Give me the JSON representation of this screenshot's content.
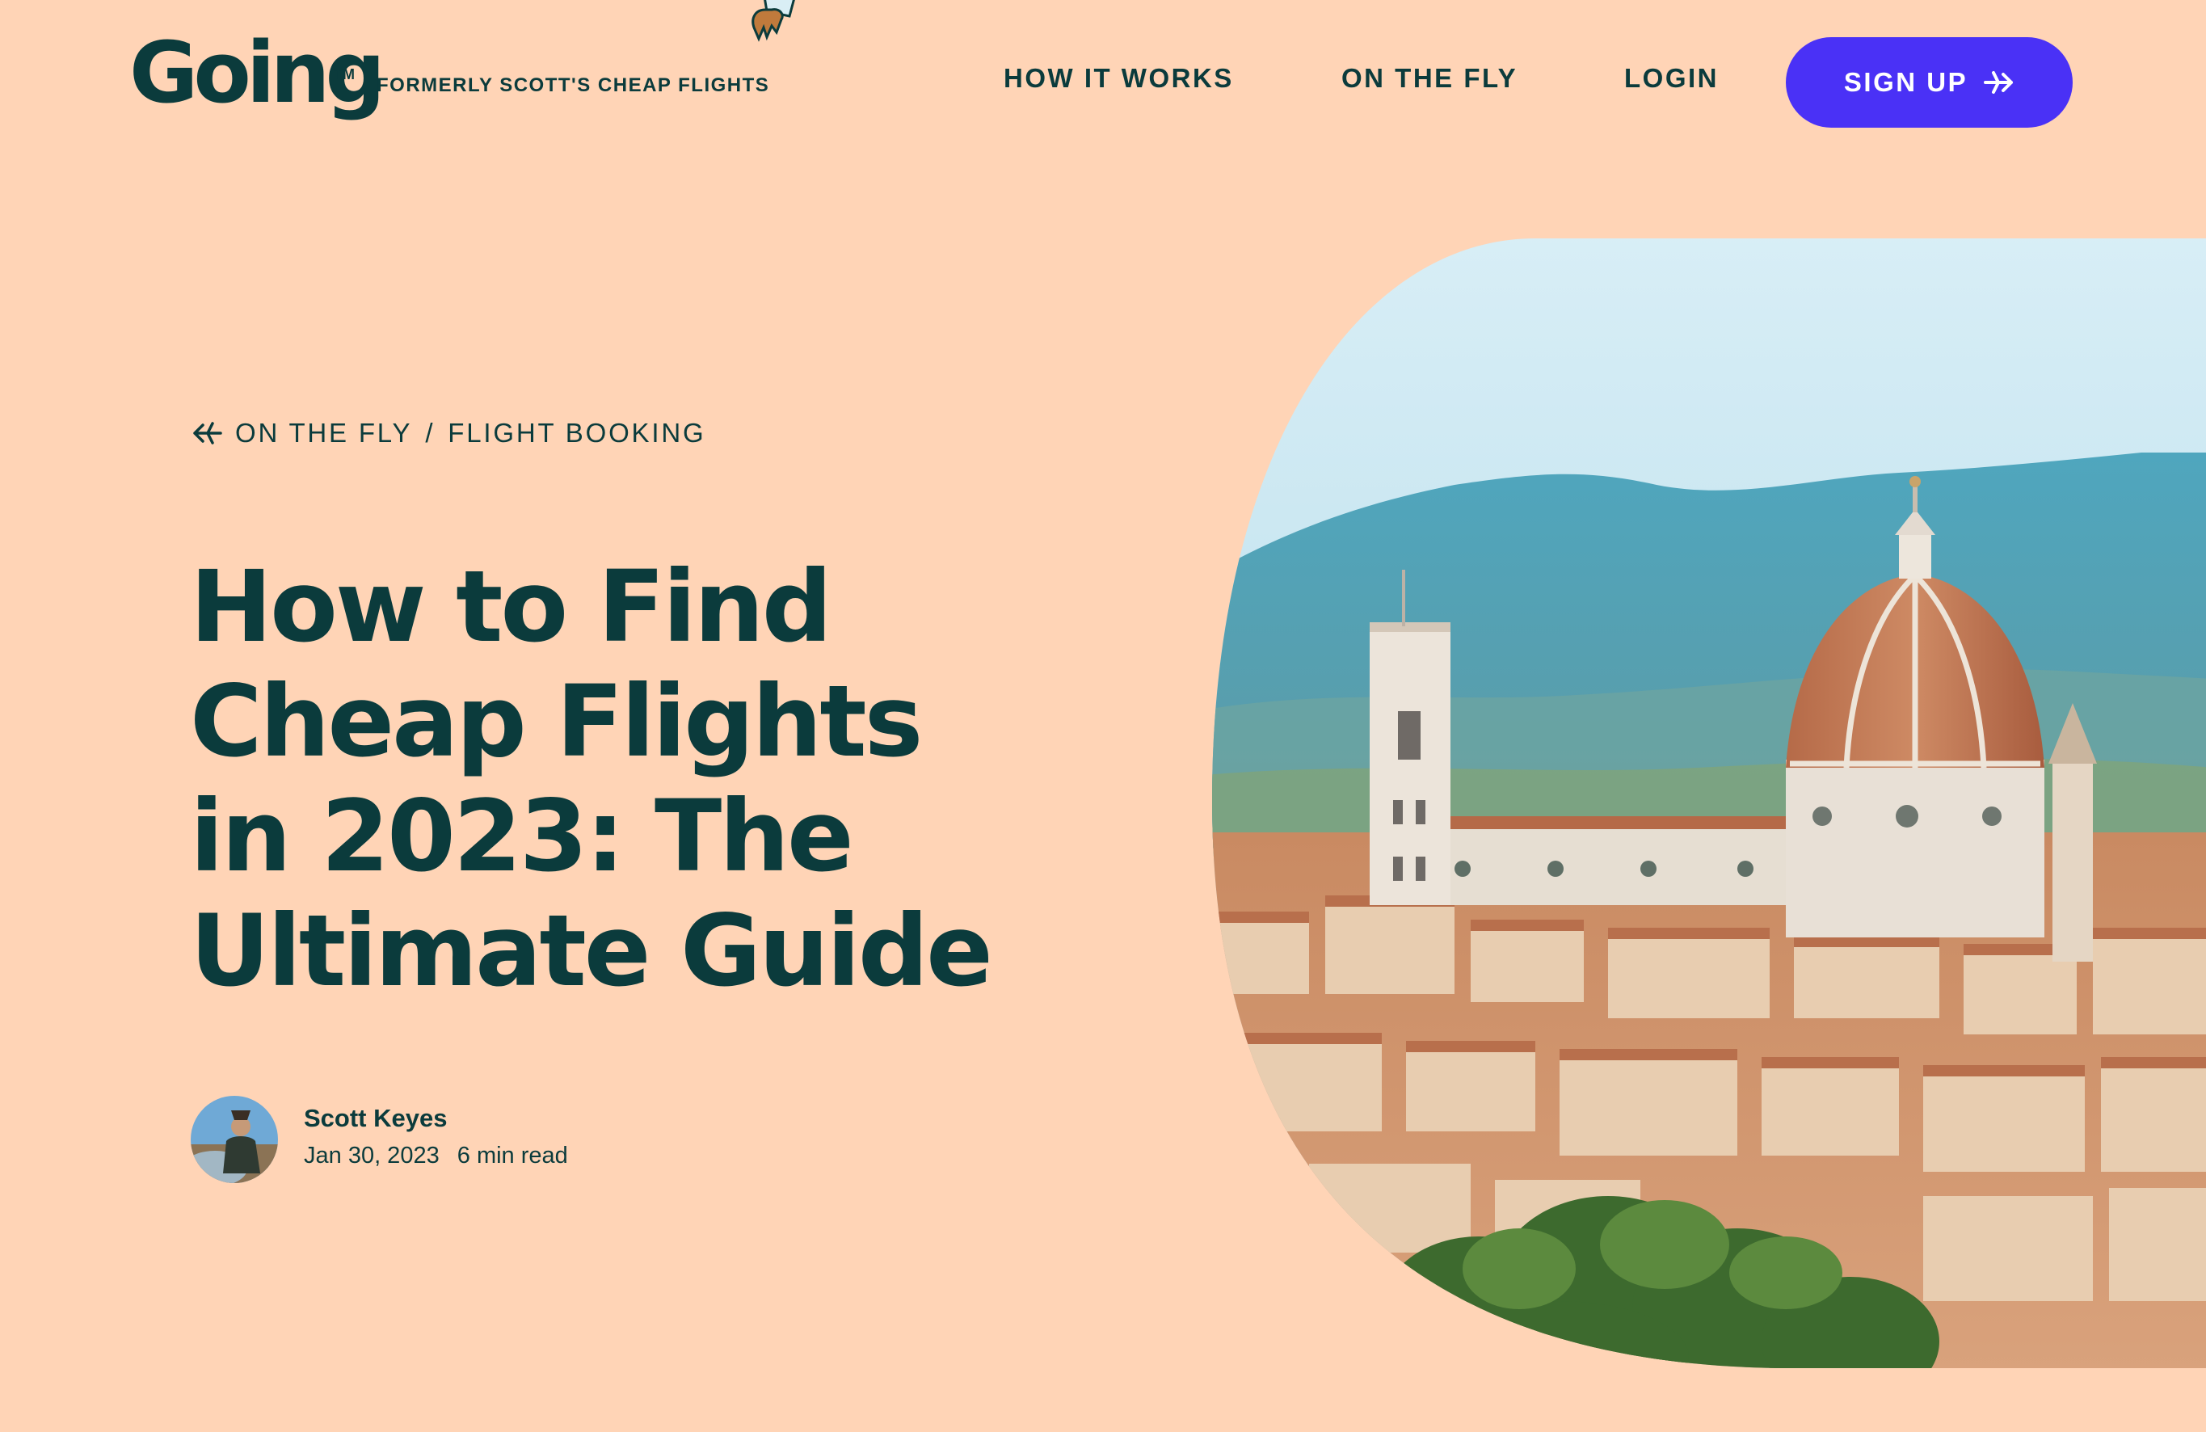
{
  "header": {
    "logo_text": "Going",
    "logo_tm": "TM",
    "tagline": "FORMERLY SCOTT'S CHEAP FLIGHTS",
    "nav": [
      {
        "label": "HOW IT WORKS"
      },
      {
        "label": "ON THE FLY"
      },
      {
        "label": "LOGIN"
      }
    ],
    "signup_label": "SIGN UP"
  },
  "breadcrumb": {
    "section": "ON THE FLY",
    "separator": "/",
    "category": "FLIGHT BOOKING"
  },
  "article": {
    "title": "How to Find Cheap Flights in 2023: The Ultimate Guide",
    "author": "Scott Keyes",
    "date": "Jan 30, 2023",
    "read_time": "6 min read"
  },
  "colors": {
    "background": "#FFD4B6",
    "text": "#0B3B3C",
    "accent": "#4A31F6"
  },
  "icons": {
    "signup": "plane-icon",
    "breadcrumb": "plane-back-icon"
  }
}
